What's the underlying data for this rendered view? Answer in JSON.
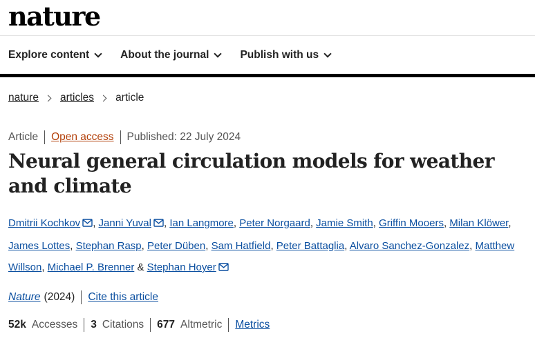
{
  "header": {
    "logo": "nature"
  },
  "nav": [
    {
      "label": "Explore content"
    },
    {
      "label": "About the journal"
    },
    {
      "label": "Publish with us"
    }
  ],
  "breadcrumb": {
    "items": [
      "nature",
      "articles"
    ],
    "current": "article"
  },
  "meta": {
    "type": "Article",
    "open_access": "Open access",
    "published": "Published: 22 July 2024"
  },
  "title": "Neural general circulation models for weather and climate",
  "authors": [
    {
      "name": "Dmitrii Kochkov",
      "sep": ",",
      "mail": true
    },
    {
      "name": "Janni Yuval",
      "sep": ",",
      "mail": true
    },
    {
      "name": "Ian Langmore",
      "sep": ",",
      "mail": false
    },
    {
      "name": "Peter Norgaard",
      "sep": ",",
      "mail": false
    },
    {
      "name": "Jamie Smith",
      "sep": ",",
      "mail": false
    },
    {
      "name": "Griffin Mooers",
      "sep": ",",
      "mail": false
    },
    {
      "name": "Milan Klöwer",
      "sep": ",",
      "mail": false
    },
    {
      "name": "James Lottes",
      "sep": ",",
      "mail": false
    },
    {
      "name": "Stephan Rasp",
      "sep": ",",
      "mail": false
    },
    {
      "name": "Peter Düben",
      "sep": ",",
      "mail": false
    },
    {
      "name": "Sam Hatfield",
      "sep": ",",
      "mail": false
    },
    {
      "name": "Peter Battaglia",
      "sep": ",",
      "mail": false
    },
    {
      "name": "Alvaro Sanchez-Gonzalez",
      "sep": ",",
      "mail": false
    },
    {
      "name": "Matthew Willson",
      "sep": ",",
      "mail": false
    },
    {
      "name": "Michael P. Brenner",
      "sep": " &",
      "mail": false
    },
    {
      "name": "Stephan Hoyer",
      "sep": "",
      "mail": true
    }
  ],
  "journal": {
    "name": "Nature",
    "year": "(2024)",
    "cite": "Cite this article"
  },
  "metrics": {
    "accesses_value": "52k",
    "accesses_label": "Accesses",
    "citations_value": "3",
    "citations_label": "Citations",
    "altmetric_value": "677",
    "altmetric_label": "Altmetric",
    "metrics_link": "Metrics"
  },
  "colors": {
    "link": "#0b4fa0",
    "open_access": "#b3400a"
  }
}
